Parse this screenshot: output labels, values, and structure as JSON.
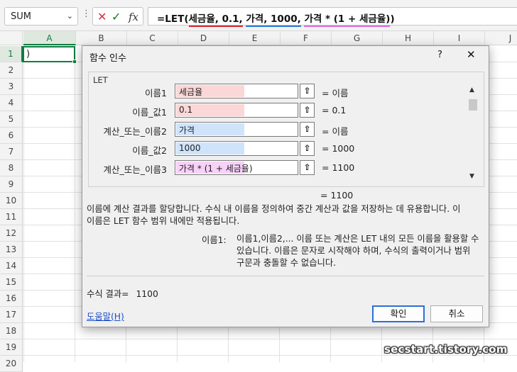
{
  "formula_bar": {
    "name_box": "SUM",
    "dots": "⋮",
    "formula_prefix": "=LET(",
    "formula_arg1": "세금율, 0.1,",
    "formula_arg2": "가격, 1000,",
    "formula_arg3": "가격 * (1 + 세금율)",
    "formula_suffix": ")"
  },
  "grid": {
    "columns": [
      "A",
      "B",
      "C",
      "D",
      "E",
      "F",
      "G",
      "H",
      "I",
      "J"
    ],
    "rows": [
      "1",
      "2",
      "3",
      "4",
      "5",
      "6",
      "7",
      "8",
      "9",
      "10",
      "11",
      "12",
      "13",
      "14",
      "15",
      "16",
      "17",
      "18",
      "19",
      "20"
    ],
    "cell_a1": ")"
  },
  "dialog": {
    "title": "함수 인수",
    "help_icon": "?",
    "close_icon": "✕",
    "function_name": "LET",
    "args": [
      {
        "label": "이름1",
        "value": "세금율",
        "result": "= 이름",
        "highlight": "#fbd7d7"
      },
      {
        "label": "이름_값1",
        "value": "0.1",
        "result": "= 0.1",
        "highlight": "#fbd7d7"
      },
      {
        "label": "계산_또는_이름2",
        "value": "가격",
        "result": "= 이름",
        "highlight": "#cfe3fb"
      },
      {
        "label": "이름_값2",
        "value": "1000",
        "result": "= 1000",
        "highlight": "#cfe3fb"
      },
      {
        "label": "계산_또는_이름3",
        "value": "가격 * (1 + 세금율)",
        "result": "= 1100",
        "highlight": "#f7d1f7"
      }
    ],
    "overall_result": "=   1100",
    "description_line1": "이름에 계산 결과를 할당합니다. 수식 내 이름을 정의하여 중간 계산과 값을 저장하는 데 유용합니다. 이",
    "description_line2": "이름은 LET 함수 범위 내에만 적용됩니다.",
    "arg_desc_name": "이름1:",
    "arg_desc_line1": "이름1,이름2,... 이름 또는 계산은 LET 내의 모든 이름을 활용할 수",
    "arg_desc_line2": "있습니다. 이름은 문자로 시작해야 하며, 수식의 출력이거나 범위",
    "arg_desc_line3": "구문과 충돌할 수 없습니다.",
    "result_label": "수식 결과=",
    "result_value": "1100",
    "help_link": "도움말(H)",
    "ok": "확인",
    "cancel": "취소"
  },
  "watermark": "secstart.tistory.com",
  "colors": {
    "accent_green": "#107c41",
    "red_underline": "#d8262b",
    "blue_underline": "#2a7ad6",
    "pink_underline": "#e06be0"
  }
}
